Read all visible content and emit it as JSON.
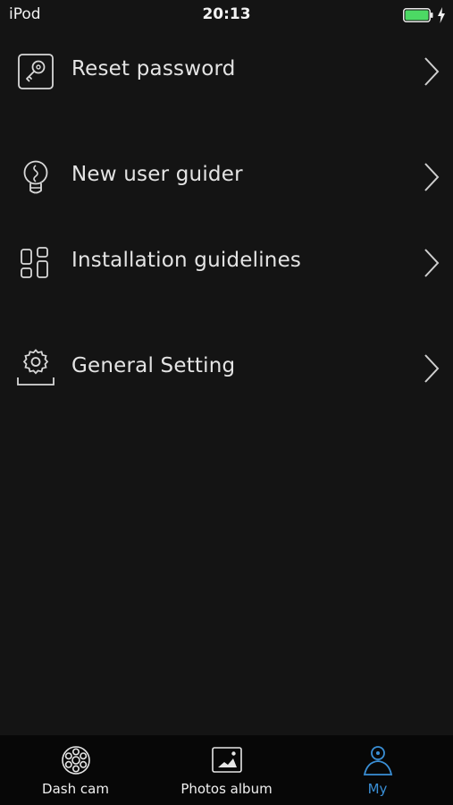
{
  "status_bar": {
    "carrier": "iPod",
    "time": "20:13",
    "battery_color": "#4cd964"
  },
  "menu": {
    "items": [
      {
        "label": "Reset password",
        "icon": "key-icon"
      },
      {
        "label": "New user guider",
        "icon": "lightbulb-icon"
      },
      {
        "label": "Installation guidelines",
        "icon": "grid-blocks-icon"
      },
      {
        "label": "General Setting",
        "icon": "gear-icon"
      }
    ]
  },
  "tab_bar": {
    "tabs": [
      {
        "label": "Dash cam",
        "icon": "camera-lens-icon",
        "active": false
      },
      {
        "label": "Photos album",
        "icon": "photo-icon",
        "active": false
      },
      {
        "label": "My",
        "icon": "person-icon",
        "active": true
      }
    ],
    "active_color": "#3a8fd6"
  }
}
